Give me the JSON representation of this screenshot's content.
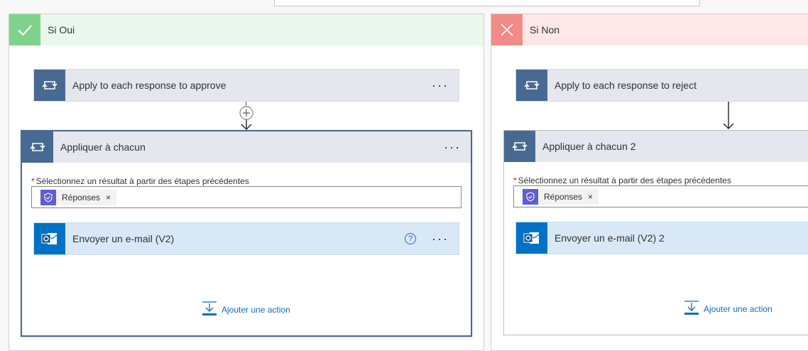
{
  "yes_branch": {
    "label": "Si Oui",
    "apply_to_each": {
      "title": "Apply to each response to approve"
    },
    "scope": {
      "title": "Appliquer à chacun",
      "field_label": "Sélectionnez un résultat à partir des étapes précédentes",
      "token": "Réponses",
      "token_remove": "×",
      "email_action": {
        "title": "Envoyer un e-mail (V2)",
        "help": "?"
      },
      "add_action": "Ajouter une action"
    }
  },
  "no_branch": {
    "label": "Si Non",
    "apply_to_each": {
      "title": "Apply to each response to reject"
    },
    "scope": {
      "title": "Appliquer à chacun 2",
      "field_label": "Sélectionnez un résultat à partir des étapes précédentes",
      "token": "Réponses",
      "token_remove": "×",
      "email_action": {
        "title": "Envoyer un e-mail (V2) 2"
      },
      "add_action": "Ajouter une action"
    }
  },
  "common": {
    "required_mark": "*",
    "more_dots": "···"
  },
  "colors": {
    "yes_accent": "#7fd28b",
    "no_accent": "#f28b85",
    "loop_icon_bg": "#486991",
    "mail_icon_bg": "#0072c6",
    "token_icon_bg": "#5f5cd6",
    "link": "#0f6cbd"
  },
  "icons": {
    "branch_yes": "check-icon",
    "branch_no": "close-icon",
    "loop": "loop-icon",
    "mail": "outlook-icon",
    "token": "approvals-icon",
    "add": "insert-icon",
    "insert_step": "plus-circle-icon",
    "arrow": "arrow-down-icon"
  }
}
